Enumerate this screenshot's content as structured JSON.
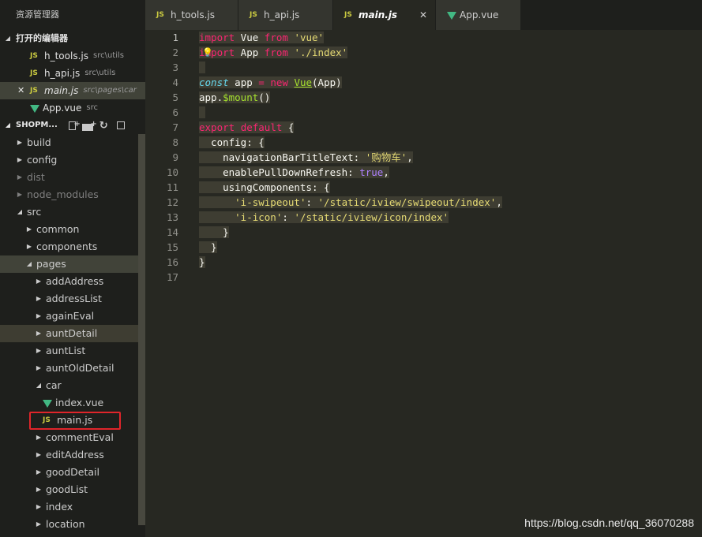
{
  "sidebar": {
    "title": "资源管理器",
    "open_editors": {
      "label": "打开的编辑器",
      "items": [
        {
          "icon": "js-icon",
          "name": "h_tools.js",
          "path": "src\\utils"
        },
        {
          "icon": "js-icon",
          "name": "h_api.js",
          "path": "src\\utils"
        },
        {
          "icon": "js-icon",
          "name": "main.js",
          "path": "src\\pages\\car",
          "active": true,
          "close": "✕"
        },
        {
          "icon": "vue-icon",
          "name": "App.vue",
          "path": "src"
        }
      ]
    },
    "project": {
      "label": "SHOPM...",
      "tools": [
        "new-file-icon",
        "new-folder-icon",
        "refresh-icon",
        "collapse-all-icon"
      ]
    },
    "tree": [
      {
        "label": "build",
        "level": 1,
        "type": "folder"
      },
      {
        "label": "config",
        "level": 1,
        "type": "folder"
      },
      {
        "label": "dist",
        "level": 1,
        "type": "folder",
        "dim": true
      },
      {
        "label": "node_modules",
        "level": 1,
        "type": "folder",
        "dim": true
      },
      {
        "label": "src",
        "level": 1,
        "type": "folder",
        "open": true
      },
      {
        "label": "common",
        "level": 2,
        "type": "folder"
      },
      {
        "label": "components",
        "level": 2,
        "type": "folder"
      },
      {
        "label": "pages",
        "level": 2,
        "type": "folder",
        "open": true,
        "selected": true
      },
      {
        "label": "addAddress",
        "level": 3,
        "type": "folder"
      },
      {
        "label": "addressList",
        "level": 3,
        "type": "folder"
      },
      {
        "label": "againEval",
        "level": 3,
        "type": "folder"
      },
      {
        "label": "auntDetail",
        "level": 3,
        "type": "folder",
        "hover": true
      },
      {
        "label": "auntList",
        "level": 3,
        "type": "folder"
      },
      {
        "label": "auntOldDetail",
        "level": 3,
        "type": "folder"
      },
      {
        "label": "car",
        "level": 3,
        "type": "folder",
        "open": true
      },
      {
        "label": "index.vue",
        "level": 4,
        "type": "vue"
      },
      {
        "label": "main.js",
        "level": 4,
        "type": "js"
      },
      {
        "label": "commentEval",
        "level": 3,
        "type": "folder"
      },
      {
        "label": "editAddress",
        "level": 3,
        "type": "folder"
      },
      {
        "label": "goodDetail",
        "level": 3,
        "type": "folder"
      },
      {
        "label": "goodList",
        "level": 3,
        "type": "folder"
      },
      {
        "label": "index",
        "level": 3,
        "type": "folder"
      },
      {
        "label": "location",
        "level": 3,
        "type": "folder"
      }
    ]
  },
  "tabs": [
    {
      "icon": "js-icon",
      "label": "h_tools.js"
    },
    {
      "icon": "js-icon",
      "label": "h_api.js"
    },
    {
      "icon": "js-icon",
      "label": "main.js",
      "active": true,
      "close": "✕"
    },
    {
      "icon": "vue-icon",
      "label": "App.vue"
    }
  ],
  "editor": {
    "line_numbers": [
      "1",
      "2",
      "3",
      "4",
      "5",
      "6",
      "7",
      "8",
      "9",
      "10",
      "11",
      "12",
      "13",
      "14",
      "15",
      "16",
      "17"
    ],
    "current_line": "1"
  },
  "colors": {
    "background": "#272822",
    "keyword": "#f92672",
    "string": "#e6db74",
    "function": "#a6e22e",
    "constant": "#ae81ff",
    "storage": "#66d9ef",
    "highlight_box": "#e0252a"
  },
  "watermark": "https://blog.csdn.net/qq_36070288"
}
